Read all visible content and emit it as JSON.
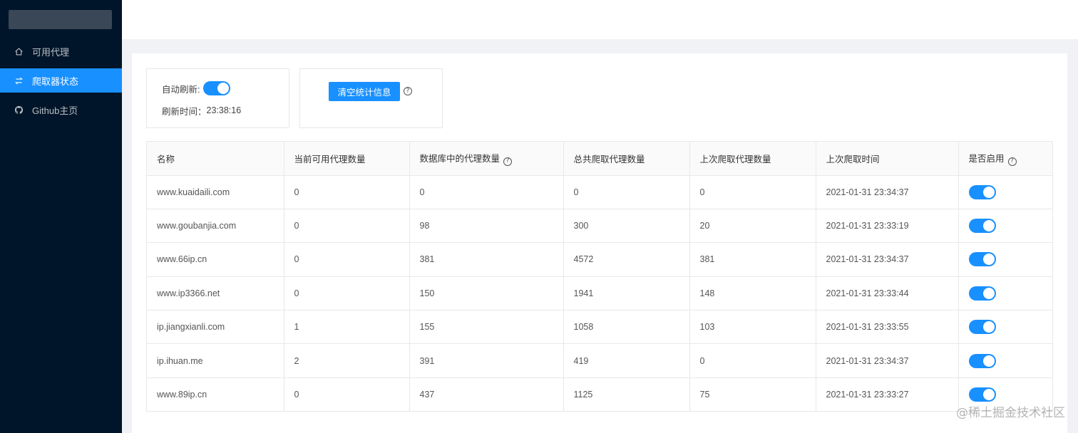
{
  "sidebar": {
    "items": [
      {
        "label": "可用代理",
        "icon": "home-icon",
        "active": false
      },
      {
        "label": "爬取器状态",
        "icon": "swap-icon",
        "active": true
      },
      {
        "label": "Github主页",
        "icon": "github-icon",
        "active": false
      }
    ]
  },
  "controls": {
    "auto_refresh_label": "自动刷新:",
    "auto_refresh_on": true,
    "refresh_time_label": "刷新时间：",
    "refresh_time_value": "23:38:16",
    "clear_button_label": "清空统计信息",
    "help_glyph": "?"
  },
  "table": {
    "columns": [
      "名称",
      "当前可用代理数量",
      "数据库中的代理数量",
      "总共爬取代理数量",
      "上次爬取代理数量",
      "上次爬取时间",
      "是否启用"
    ],
    "rows": [
      {
        "name": "www.kuaidaili.com",
        "available": "0",
        "in_db": "0",
        "total": "0",
        "last": "0",
        "last_time": "2021-01-31 23:34:37",
        "enabled": true
      },
      {
        "name": "www.goubanjia.com",
        "available": "0",
        "in_db": "98",
        "total": "300",
        "last": "20",
        "last_time": "2021-01-31 23:33:19",
        "enabled": true
      },
      {
        "name": "www.66ip.cn",
        "available": "0",
        "in_db": "381",
        "total": "4572",
        "last": "381",
        "last_time": "2021-01-31 23:34:37",
        "enabled": true
      },
      {
        "name": "www.ip3366.net",
        "available": "0",
        "in_db": "150",
        "total": "1941",
        "last": "148",
        "last_time": "2021-01-31 23:33:44",
        "enabled": true
      },
      {
        "name": "ip.jiangxianli.com",
        "available": "1",
        "in_db": "155",
        "total": "1058",
        "last": "103",
        "last_time": "2021-01-31 23:33:55",
        "enabled": true
      },
      {
        "name": "ip.ihuan.me",
        "available": "2",
        "in_db": "391",
        "total": "419",
        "last": "0",
        "last_time": "2021-01-31 23:34:37",
        "enabled": true
      },
      {
        "name": "www.89ip.cn",
        "available": "0",
        "in_db": "437",
        "total": "1125",
        "last": "75",
        "last_time": "2021-01-31 23:33:27",
        "enabled": true
      }
    ]
  },
  "watermark": "@稀土掘金技术社区",
  "colors": {
    "sidebar_bg": "#001529",
    "accent": "#1890ff"
  }
}
